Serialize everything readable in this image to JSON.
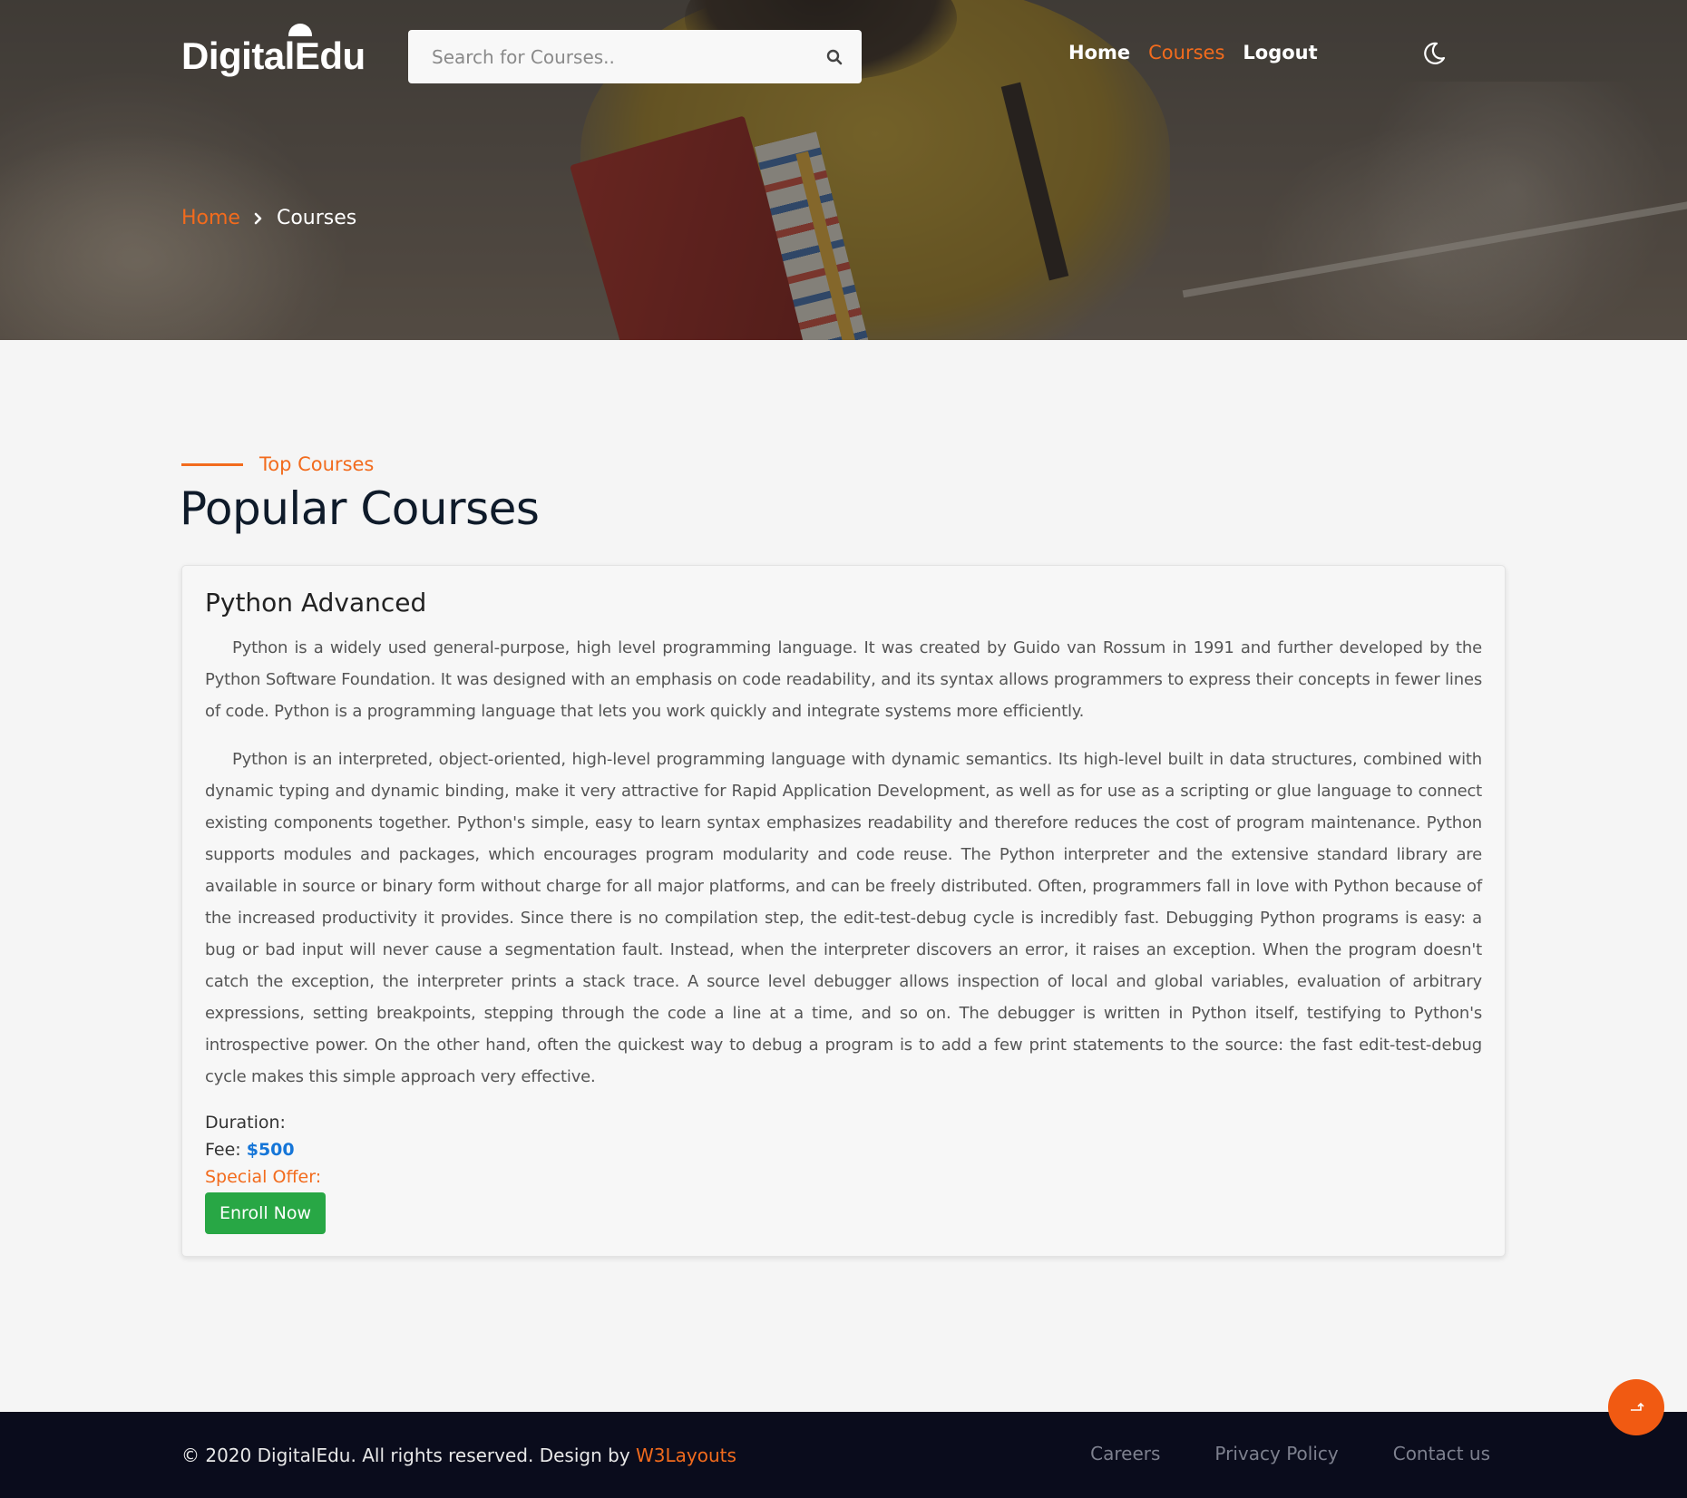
{
  "header": {
    "logo": "DigitalEdu",
    "search": {
      "placeholder": "Search for Courses..",
      "value": ""
    },
    "nav": [
      {
        "label": "Home"
      },
      {
        "label": "Courses",
        "active": true
      },
      {
        "label": "Logout"
      }
    ],
    "theme_icon": "moon-icon"
  },
  "breadcrumb": {
    "home": "Home",
    "current": "Courses"
  },
  "section": {
    "tag": "Top Courses",
    "title": "Popular Courses"
  },
  "course": {
    "title": "Python Advanced",
    "paragraphs": [
      "Python is a widely used general-purpose, high level programming language. It was created by Guido van Rossum in 1991 and further developed by the Python Software Foundation. It was designed with an emphasis on code readability, and its syntax allows programmers to express their concepts in fewer lines of code. Python is a programming language that lets you work quickly and integrate systems more efficiently.",
      "Python is an interpreted, object-oriented, high-level programming language with dynamic semantics. Its high-level built in data structures, combined with dynamic typing and dynamic binding, make it very attractive for Rapid Application Development, as well as for use as a scripting or glue language to connect existing components together. Python's simple, easy to learn syntax emphasizes readability and therefore reduces the cost of program maintenance. Python supports modules and packages, which encourages program modularity and code reuse. The Python interpreter and the extensive standard library are available in source or binary form without charge for all major platforms, and can be freely distributed. Often, programmers fall in love with Python because of the increased productivity it provides. Since there is no compilation step, the edit-test-debug cycle is incredibly fast. Debugging Python programs is easy: a bug or bad input will never cause a segmentation fault. Instead, when the interpreter discovers an error, it raises an exception. When the program doesn't catch the exception, the interpreter prints a stack trace. A source level debugger allows inspection of local and global variables, evaluation of arbitrary expressions, setting breakpoints, stepping through the code a line at a time, and so on. The debugger is written in Python itself, testifying to Python's introspective power. On the other hand, often the quickest way to debug a program is to add a few print statements to the source: the fast edit-test-debug cycle makes this simple approach very effective."
    ],
    "duration_label": "Duration:",
    "fee_label": "Fee:",
    "fee_value": "$500",
    "offer_label": "Special Offer:",
    "enroll_label": "Enroll Now"
  },
  "footer": {
    "copyright_prefix": "© 2020 DigitalEdu. All rights reserved. Design by ",
    "designer": "W3Layouts",
    "links": [
      "Careers",
      "Privacy Policy",
      "Contact us"
    ]
  },
  "colors": {
    "accent": "#f26b1d",
    "price": "#1676d8",
    "enroll": "#28a745",
    "footer_bg": "#0a0c1c"
  }
}
